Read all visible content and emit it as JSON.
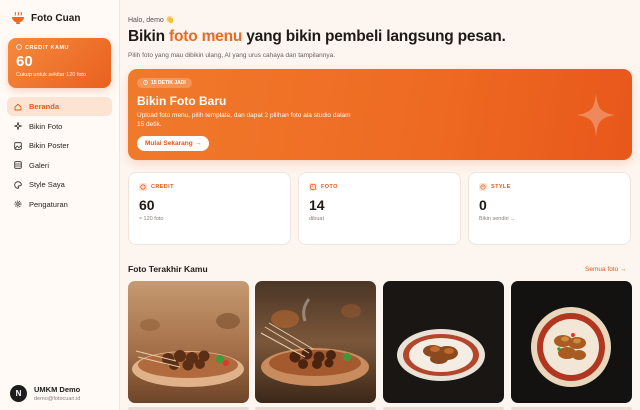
{
  "app": {
    "name": "Foto Cuan"
  },
  "credit_card": {
    "label": "CREDIT KAMU",
    "value": "60",
    "sub": "Cukup untuk sekitar 120 foto"
  },
  "nav": [
    {
      "label": "Beranda",
      "icon": "home-icon",
      "active": true
    },
    {
      "label": "Bikin Foto",
      "icon": "sparkle-icon"
    },
    {
      "label": "Bikin Poster",
      "icon": "image-icon"
    },
    {
      "label": "Galeri",
      "icon": "grid-icon"
    },
    {
      "label": "Style Saya",
      "icon": "palette-icon"
    },
    {
      "label": "Pengaturan",
      "icon": "gear-icon"
    }
  ],
  "user": {
    "initial": "N",
    "name": "UMKM Demo",
    "email": "demo@fotocuan.id"
  },
  "header": {
    "greeting": "Halo, demo 👋",
    "headline_pre": "Bikin ",
    "headline_accent": "foto menu",
    "headline_post": " yang bikin pembeli langsung pesan.",
    "subhead": "Pilih foto yang mau dibikin ulang, AI yang urus cahaya dan tampilannya."
  },
  "hero": {
    "badge": "15 DETIK JADI",
    "title": "Bikin Foto Baru",
    "description": "Upload foto menu, pilih template, dan dapat 2 pilihan foto ala studio dalam 15 detik.",
    "button": "Mulai Sekarang →"
  },
  "stats": [
    {
      "label": "CREDIT",
      "value": "60",
      "sub": "≈ 120 foto",
      "icon": "coin-icon"
    },
    {
      "label": "FOTO",
      "value": "14",
      "sub": "dibuat",
      "icon": "photo-icon"
    },
    {
      "label": "STYLE",
      "value": "0",
      "sub": "Bikin sendiri →",
      "icon": "palette-icon"
    }
  ],
  "recent": {
    "title": "Foto Terakhir Kamu",
    "see_all": "Semua foto →"
  },
  "colors": {
    "accent": "#ea6a22",
    "accent_dark": "#e2591b",
    "background": "#fdf6f0"
  }
}
